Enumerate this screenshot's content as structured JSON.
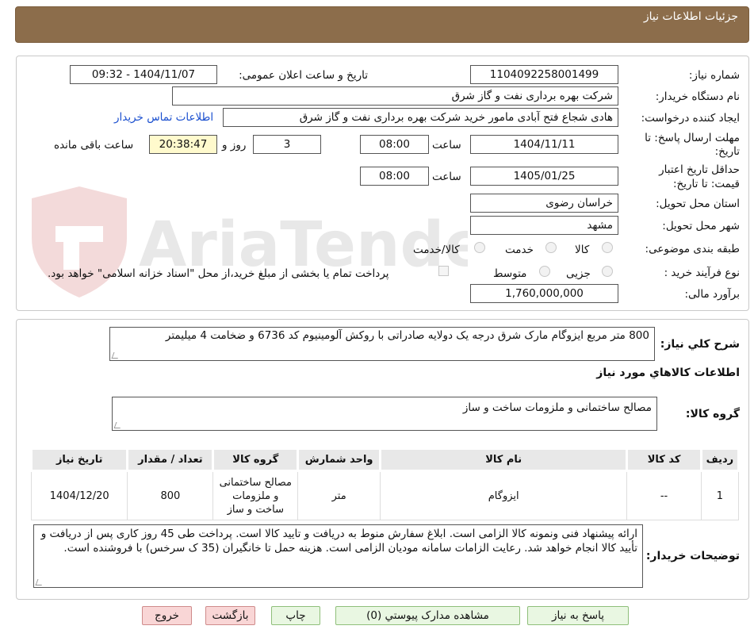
{
  "header": {
    "title": "جزئیات اطلاعات نیاز"
  },
  "watermark": {
    "text": "AriaTender.neT"
  },
  "fields": {
    "need_number_label": "شماره نیاز:",
    "need_number": "1104092258001499",
    "announce_label": "تاریخ و ساعت اعلان عمومی:",
    "announce_value": "1404/11/07 - 09:32",
    "buyer_org_label": "نام دستگاه خریدار:",
    "buyer_org": "شرکت بهره برداری نفت و گاز شرق",
    "creator_label": "ایجاد کننده درخواست:",
    "creator": "هادی شجاع فتح آبادی مامور خرید شرکت بهره برداری نفت و گاز شرق",
    "contact_link": "اطلاعات تماس خریدار",
    "deadline_label_1": "مهلت ارسال پاسخ: تا",
    "deadline_label_2": "تاریخ:",
    "deadline_date": "1404/11/11",
    "time_label": "ساعت",
    "deadline_time": "08:00",
    "days_value": "3",
    "days_label": "روز و",
    "remaining_time": "20:38:47",
    "remaining_label": "ساعت باقی مانده",
    "validity_label_1": "حداقل تاریخ اعتبار",
    "validity_label_2": "قیمت: تا تاریخ:",
    "validity_date": "1405/01/25",
    "validity_time": "08:00",
    "province_label": "استان محل تحویل:",
    "province": "خراسان رضوی",
    "city_label": "شهر محل تحویل:",
    "city": "مشهد",
    "category_label": "طبقه بندی موضوعی:",
    "category_options": [
      "کالا",
      "خدمت",
      "کالا/خدمت"
    ],
    "process_label": "نوع فرآیند خرید :",
    "process_options": [
      "جزیی",
      "متوسط"
    ],
    "payment_note": "پرداخت تمام یا بخشی از مبلغ خرید،از محل \"اسناد خزانه اسلامی\" خواهد بود.",
    "budget_label": "برآورد مالی:",
    "budget": "1,760,000,000"
  },
  "description": {
    "label": "شرح کلي نياز:",
    "text": "800 متر مربع ایزوگام مارک شرق درجه یک دولایه صادراتی با روکش آلومینیوم کد 6736 و ضخامت 4 میلیمتر"
  },
  "goods_info_title": "اطلاعات کالاهاي مورد نياز",
  "goods_group": {
    "label": "گروه کالا:",
    "value": "مصالح ساختمانی و ملزومات ساخت و ساز"
  },
  "table": {
    "headers": [
      "رديف",
      "کد کالا",
      "نام کالا",
      "واحد شمارش",
      "گروه کالا",
      "تعداد / مقدار",
      "تاريخ نياز"
    ],
    "rows": [
      [
        "1",
        "--",
        "ایزوگام",
        "متر",
        "مصالح ساختمانی و ملزومات ساخت و ساز",
        "800",
        "1404/12/20"
      ]
    ]
  },
  "buyer_notes": {
    "label": "توضیحات خریدار:",
    "text": "ارائه پیشنهاد فنی ونمونه کالا الزامی است. ابلاغ سفارش منوط به دریافت و تایید کالا است. پرداخت طی  45 روز کاری پس از دریافت و تأیید کالا انجام خواهد شد. رعایت الزامات سامانه مودیان الزامی است. هزینه حمل تا خانگیران (35 ک سرخس) با فروشنده است."
  },
  "buttons": {
    "reply": "پاسخ به نیاز",
    "attachments": "مشاهده مدارک پیوستي (0)",
    "print": "چاپ",
    "back": "بازگشت",
    "exit": "خروج"
  }
}
